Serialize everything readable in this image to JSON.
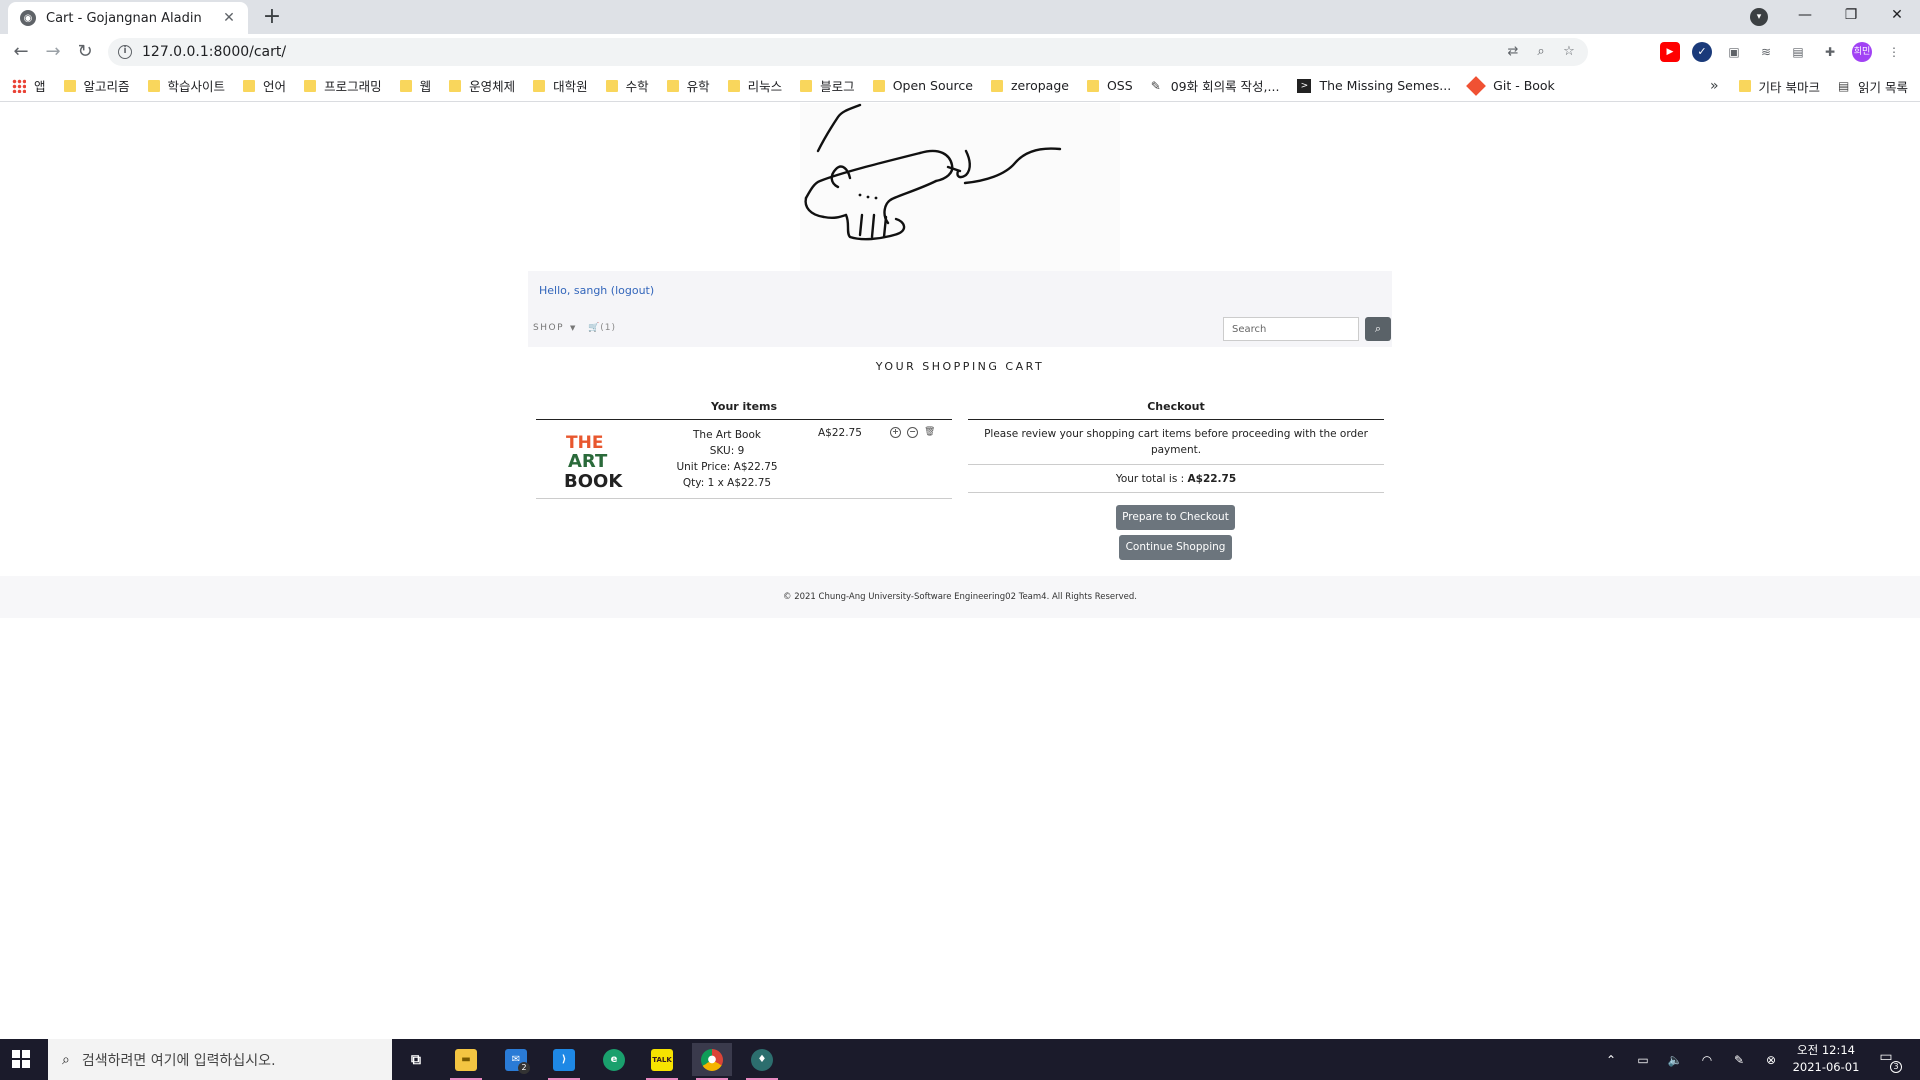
{
  "browser": {
    "tab_title": "Cart - Gojangnan Aladin",
    "tab_close": "✕",
    "new_tab": "+",
    "url": "127.0.0.1:8000/cart/",
    "profile_badge": "희민",
    "window_controls": {
      "minimize": "—",
      "restore": "❐",
      "close": "✕"
    },
    "bookmarks": [
      "앱",
      "알고리즘",
      "학습사이트",
      "언어",
      "프로그래밍",
      "웹",
      "운영체제",
      "대학원",
      "수학",
      "유학",
      "리눅스",
      "블로그",
      "Open Source",
      "zeropage",
      "OSS",
      "09화 회의록 작성,...",
      "The Missing Semes...",
      "Git - Book"
    ],
    "bookmarks_more": "»",
    "other_bookmarks": "기타 북마크",
    "reading_list": "읽기 목록"
  },
  "header": {
    "greeting": "Hello, sangh",
    "logout": "(logout)",
    "shop_menu": "SHOP",
    "cart_count": "(1)",
    "search_placeholder": "Search"
  },
  "cart": {
    "title": "YOUR SHOPPING CART",
    "items_heading": "Your items",
    "checkout_heading": "Checkout",
    "items": [
      {
        "name": "The Art Book",
        "sku": "SKU: 9",
        "unit_price": "Unit Price: A$22.75",
        "qty": "Qty: 1 x A$22.75",
        "price": "A$22.75",
        "cover_text": [
          "THE",
          "ART",
          "BOOK"
        ]
      }
    ],
    "checkout_note": "Please review your shopping cart items before proceeding with the order payment.",
    "total_label": "Your total is : ",
    "total_value": "A$22.75",
    "prepare_button": "Prepare to Checkout",
    "continue_button": "Continue Shopping"
  },
  "footer": {
    "text": "© 2021 Chung-Ang University-Software Engineering02 Team4. All Rights Reserved."
  },
  "taskbar": {
    "search_placeholder": "검색하려면 여기에 입력하십시오.",
    "mail_badge": "2",
    "kakao_label": "TALK",
    "clock_time": "오전 12:14",
    "clock_date": "2021-06-01",
    "notification_count": "3"
  },
  "colors": {
    "accent_link": "#3366bb",
    "button_gray": "#6c757d",
    "header_band": "#f5f5f8"
  }
}
